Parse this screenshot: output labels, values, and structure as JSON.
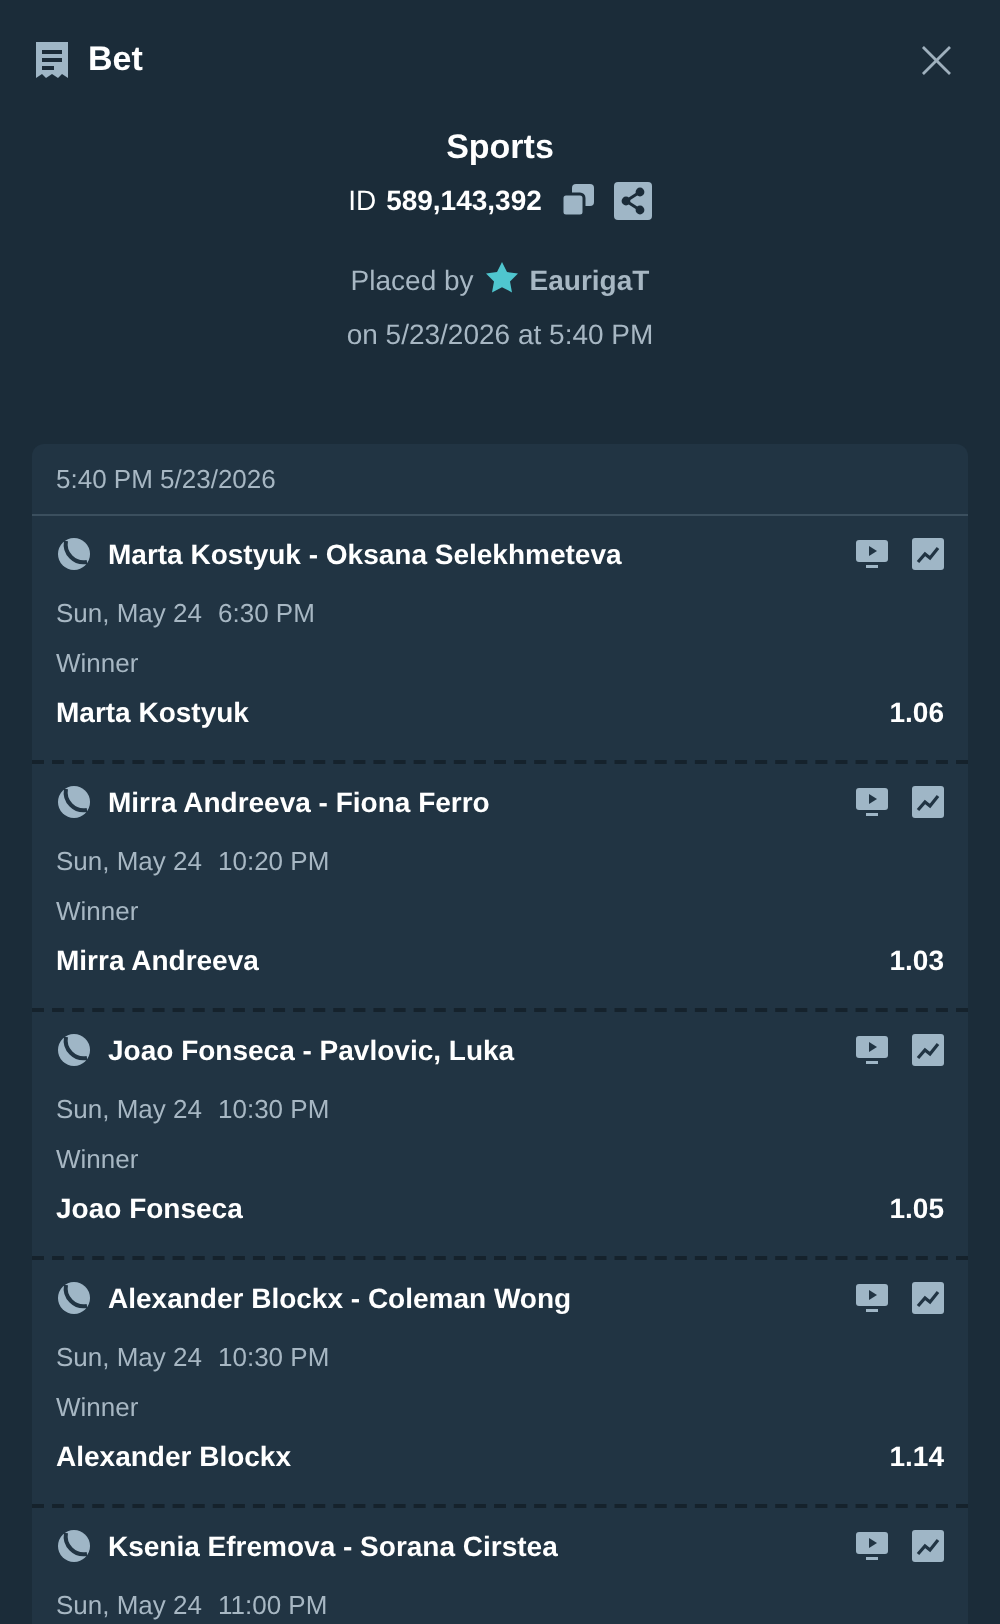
{
  "header": {
    "title": "Bet",
    "close": "×"
  },
  "summary": {
    "sport": "Sports",
    "id_label": "ID",
    "id_value": "589,143,392",
    "placed_by_label": "Placed by",
    "user": "EaurigaT",
    "placed_on": "on 5/23/2026 at 5:40 PM"
  },
  "ticket": {
    "timestamp": "5:40 PM 5/23/2026",
    "legs": [
      {
        "match": "Marta Kostyuk - Oksana Selekhmeteva",
        "date": "Sun, May 24",
        "time": "6:30 PM",
        "market": "Winner",
        "selection": "Marta Kostyuk",
        "odds": "1.06"
      },
      {
        "match": "Mirra Andreeva - Fiona Ferro",
        "date": "Sun, May 24",
        "time": "10:20 PM",
        "market": "Winner",
        "selection": "Mirra Andreeva",
        "odds": "1.03"
      },
      {
        "match": "Joao Fonseca - Pavlovic, Luka",
        "date": "Sun, May 24",
        "time": "10:30 PM",
        "market": "Winner",
        "selection": "Joao Fonseca",
        "odds": "1.05"
      },
      {
        "match": "Alexander Blockx - Coleman Wong",
        "date": "Sun, May 24",
        "time": "10:30 PM",
        "market": "Winner",
        "selection": "Alexander Blockx",
        "odds": "1.14"
      },
      {
        "match": "Ksenia Efremova - Sorana Cirstea",
        "date": "Sun, May 24",
        "time": "11:00 PM"
      }
    ]
  }
}
